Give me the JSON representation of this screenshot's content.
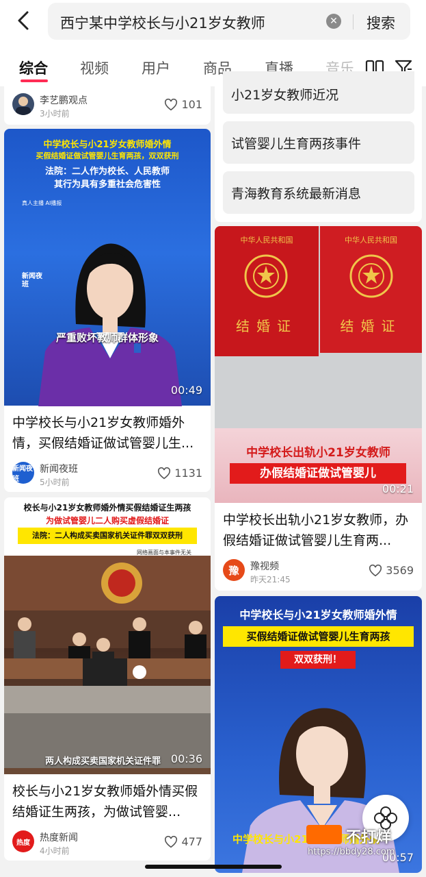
{
  "search": {
    "query": "西宁某中学校长与小21岁女教师",
    "button": "搜索"
  },
  "tabs": [
    {
      "label": "综合",
      "active": true
    },
    {
      "label": "视频"
    },
    {
      "label": "用户"
    },
    {
      "label": "商品"
    },
    {
      "label": "直播"
    },
    {
      "label": "音乐"
    }
  ],
  "left": {
    "top_card": {
      "author": "李艺鹏观点",
      "time": "3小时前",
      "likes": "101"
    },
    "card1": {
      "banner1": "中学校长与小21岁女教师婚外情",
      "banner2": "买假结婚证做试管婴儿生育两孩，双双获刑",
      "banner3": "法院：二人作为校长、人民教师",
      "banner4": "其行为具有多重社会危害性",
      "tag": "真人主播 AI播报",
      "logo": "新闻夜班",
      "caption": "严重败坏教师群体形象",
      "duration": "00:49",
      "title": "中学校长与小21岁女教师婚外情，买假结婚证做试管婴儿生...",
      "author": "新闻夜班",
      "avatar": "新闻夜班",
      "time": "5小时前",
      "likes": "1131"
    },
    "card2": {
      "banner1": "校长与小21岁女教师婚外情买假结婚证生两孩",
      "banner2": "为做试管婴儿二人购买虚假结婚证",
      "banner3": "法院：二人构成买卖国家机关证件罪双双获刑",
      "note": "网络画面与本事件无关",
      "caption": "两人构成买卖国家机关证件罪",
      "duration": "00:36",
      "title": "校长与小21岁女教师婚外情买假结婚证生两孩，为做试管婴...",
      "author": "热度新闻",
      "avatar": "热度",
      "time": "4小时前",
      "likes": "477"
    }
  },
  "right": {
    "suggestions": [
      "小21岁女教师近况",
      "试管婴儿生育两孩事件",
      "青海教育系统最新消息"
    ],
    "card1": {
      "cert_header": "中华人民共和国",
      "cert_title": "结婚证",
      "banner1": "中学校长出轨小21岁女教师",
      "banner2": "办假结婚证做试管婴儿",
      "duration": "00:21",
      "title": "中学校长出轨小21岁女教师，办假结婚证做试管婴儿生育两...",
      "author": "豫视频",
      "avatar": "豫",
      "time": "昨天21:45",
      "likes": "3569"
    },
    "card2": {
      "banner1": "中学校长与小21岁女教师婚外情",
      "banner2": "买假结婚证做试管婴儿生育两孩",
      "banner3": "双双获刑！",
      "caption": "中学校长与小21岁女教师婚外情",
      "duration": "00:57"
    }
  },
  "watermark": {
    "text": "不打烊",
    "url": "https://bbdy28.com"
  },
  "colors": {
    "accent": "#ff2c55",
    "banner_yellow": "#ffe600",
    "banner_red": "#e21b1b"
  }
}
